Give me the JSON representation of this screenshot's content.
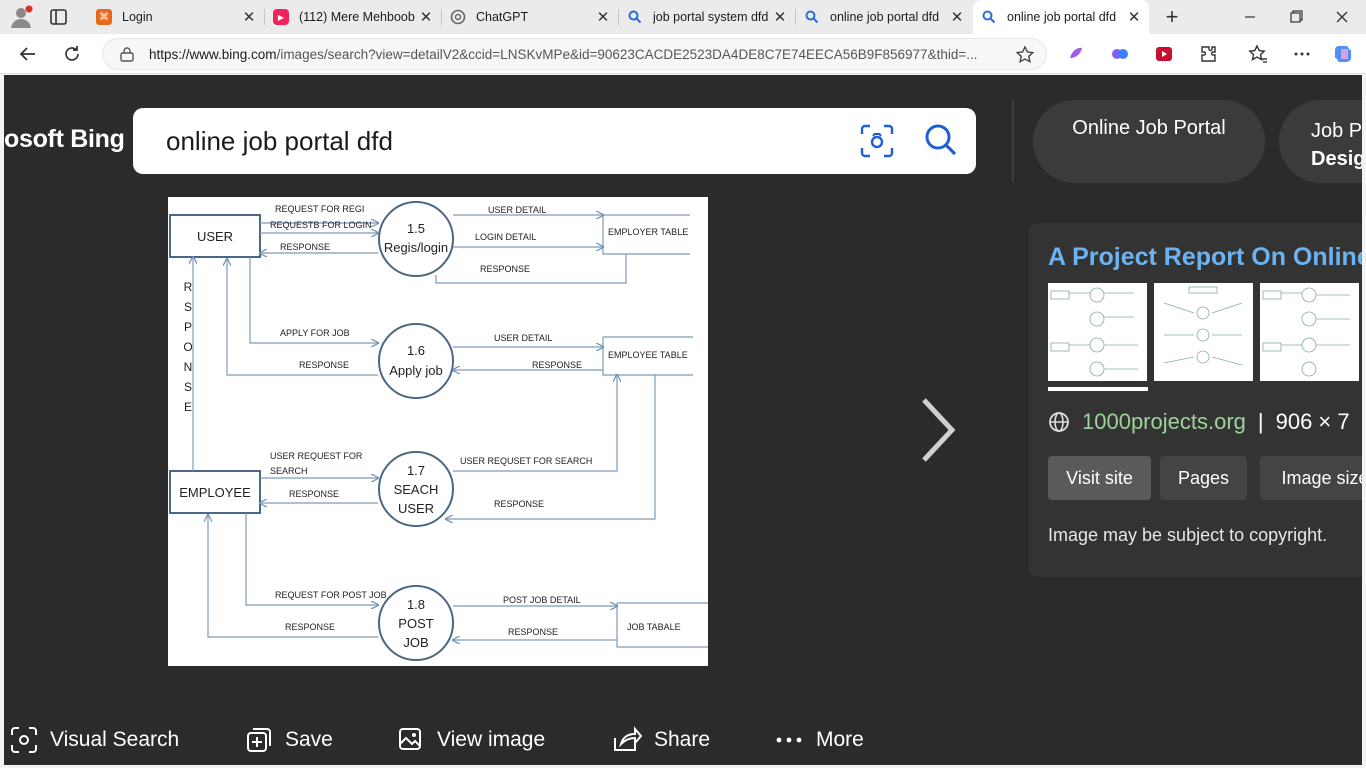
{
  "browser": {
    "tabs": [
      {
        "label": "Login",
        "icon": "login-favicon",
        "icon_color": "#e8681c"
      },
      {
        "label": "(112) Mere Mehboob",
        "icon": "youtube-favicon",
        "icon_color": "#f0245a"
      },
      {
        "label": "ChatGPT",
        "icon": "chatgpt-favicon",
        "icon_color": "#555555"
      },
      {
        "label": "job portal system dfd",
        "icon": "search-favicon",
        "icon_color": "#2a6edb"
      },
      {
        "label": "online job portal dfd",
        "icon": "search-favicon",
        "icon_color": "#2a6edb"
      },
      {
        "label": "online job portal dfd",
        "icon": "search-favicon",
        "icon_color": "#2a6edb"
      }
    ],
    "url_domain": "https://www.bing.com",
    "url_path": "/images/search?view=detailV2&ccid=LNSKvMPe&id=90623CACDE2523DA4DE8C7E74EECA56B9F856977&thid=..."
  },
  "header": {
    "brand": "osoft Bing",
    "query": "online job portal dfd",
    "chips": [
      "Online Job Portal",
      "Job P",
      "Desig"
    ]
  },
  "diagram": {
    "user": "USER",
    "employee": "EMPLOYEE",
    "response_vertical": [
      "R",
      "S",
      "P",
      "O",
      "N",
      "S",
      "E"
    ],
    "p15_num": "1.5",
    "p15_name": "Regis/login",
    "p16_num": "1.6",
    "p16_name": "Apply job",
    "p17_num": "1.7",
    "p17_l1": "SEACH",
    "p17_l2": "USER",
    "p18_num": "1.8",
    "p18_l1": "POST",
    "p18_l2": "JOB",
    "employer_table": "EMPLOYER TABLE",
    "employee_table": "EMPLOYEE TABLE",
    "job_table": "JOB TABALE",
    "f_req_regi": "REQUEST FOR REGI",
    "f_req_login": "REQUESTB FOR LOGIN",
    "f_resp1": "RESPONSE",
    "f_user_detail1": "USER DETAIL",
    "f_login_detail": "LOGIN DETAIL",
    "f_resp2": "RESPONSE",
    "f_apply": "APPLY FOR JOB",
    "f_resp3": "RESPONSE",
    "f_user_detail2": "USER DETAIL",
    "f_resp4": "RESPONSE",
    "f_usr_req1": "USER REQUEST FOR",
    "f_usr_req2": "SEARCH",
    "f_resp5": "RESPONSE",
    "f_usr_reqset": "USER REQUSET FOR SEARCH",
    "f_resp6": "RESPONSE",
    "f_req_post": "REQUEST FOR POST JOB",
    "f_resp7": "RESPONSE",
    "f_post_detail": "POST JOB DETAIL",
    "f_resp8": "RESPONSE"
  },
  "panel": {
    "title": "A Project Report On Online",
    "source": "1000projects.org",
    "separator": "|",
    "dims": "906 × 7",
    "buttons": [
      "Visit site",
      "Pages",
      "Image size"
    ],
    "copyright": "Image may be subject to copyright."
  },
  "bottom": {
    "visual_search": "Visual Search",
    "save": "Save",
    "view_image": "View image",
    "share": "Share",
    "more": "More"
  }
}
